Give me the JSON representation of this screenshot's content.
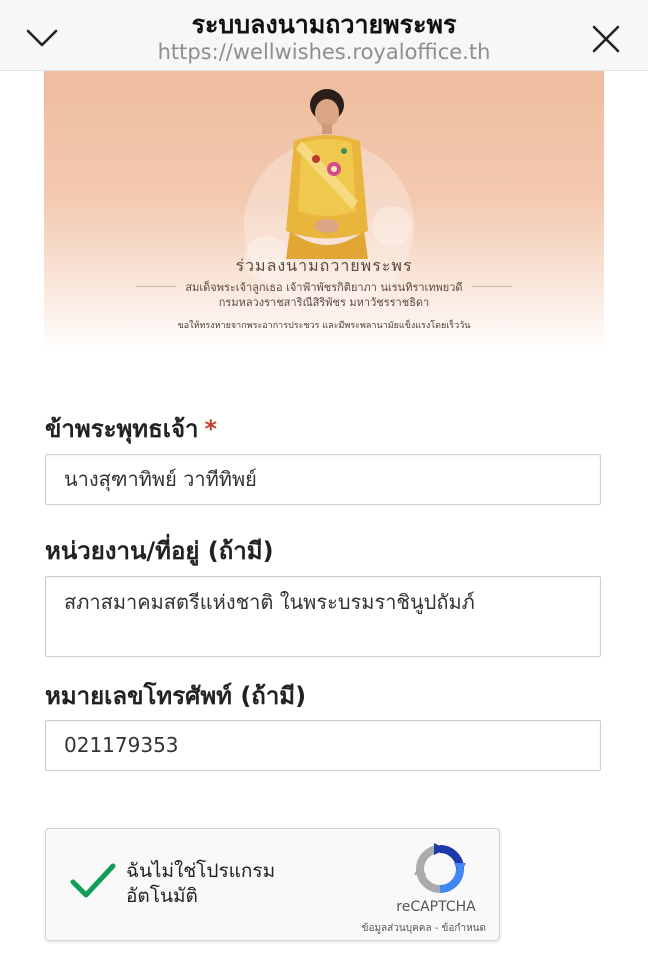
{
  "header": {
    "title": "ระบบลงนามถวายพระพร",
    "url": "https://wellwishes.royaloffice.th"
  },
  "banner": {
    "heading": "ร่วมลงนามถวายพระพร",
    "line1": "สมเด็จพระเจ้าลูกเธอ เจ้าฟ้าพัชรกิติยาภา นเรนทิราเทพยวดี",
    "line2": "กรมหลวงราชสาริณีสิริพัชร มหาวัชรราชธิดา",
    "blessing": "ขอให้ทรงหายจากพระอาการประชวร และมีพระพลานามัยแข็งแรงโดยเร็ววัน"
  },
  "form": {
    "name": {
      "label": "ข้าพระพุทธเจ้า",
      "required_mark": "*",
      "value": "นางสุฑาทิพย์ วาทีทิพย์"
    },
    "address": {
      "label": "หน่วยงาน/ที่อยู่ (ถ้ามี)",
      "value": "สภาสมาคมสตรีแห่งชาติ ในพระบรมราชินูปถัมภ์"
    },
    "phone": {
      "label": "หมายเลขโทรศัพท์ (ถ้ามี)",
      "value": "021179353"
    }
  },
  "captcha": {
    "label": "ฉันไม่ใช่โปรแกรมอัตโนมัติ",
    "brand": "reCAPTCHA",
    "terms": "ข้อมูลส่วนบุคคล - ข้อกำหนด",
    "checked": true
  },
  "colors": {
    "required": "#c63a2c",
    "check": "#0f9d58",
    "banner_peach": "#efbc9e"
  },
  "icons": {
    "back": "chevron-down-icon",
    "close": "close-icon",
    "check": "checkmark-icon",
    "captcha_logo": "recaptcha-logo-icon"
  }
}
